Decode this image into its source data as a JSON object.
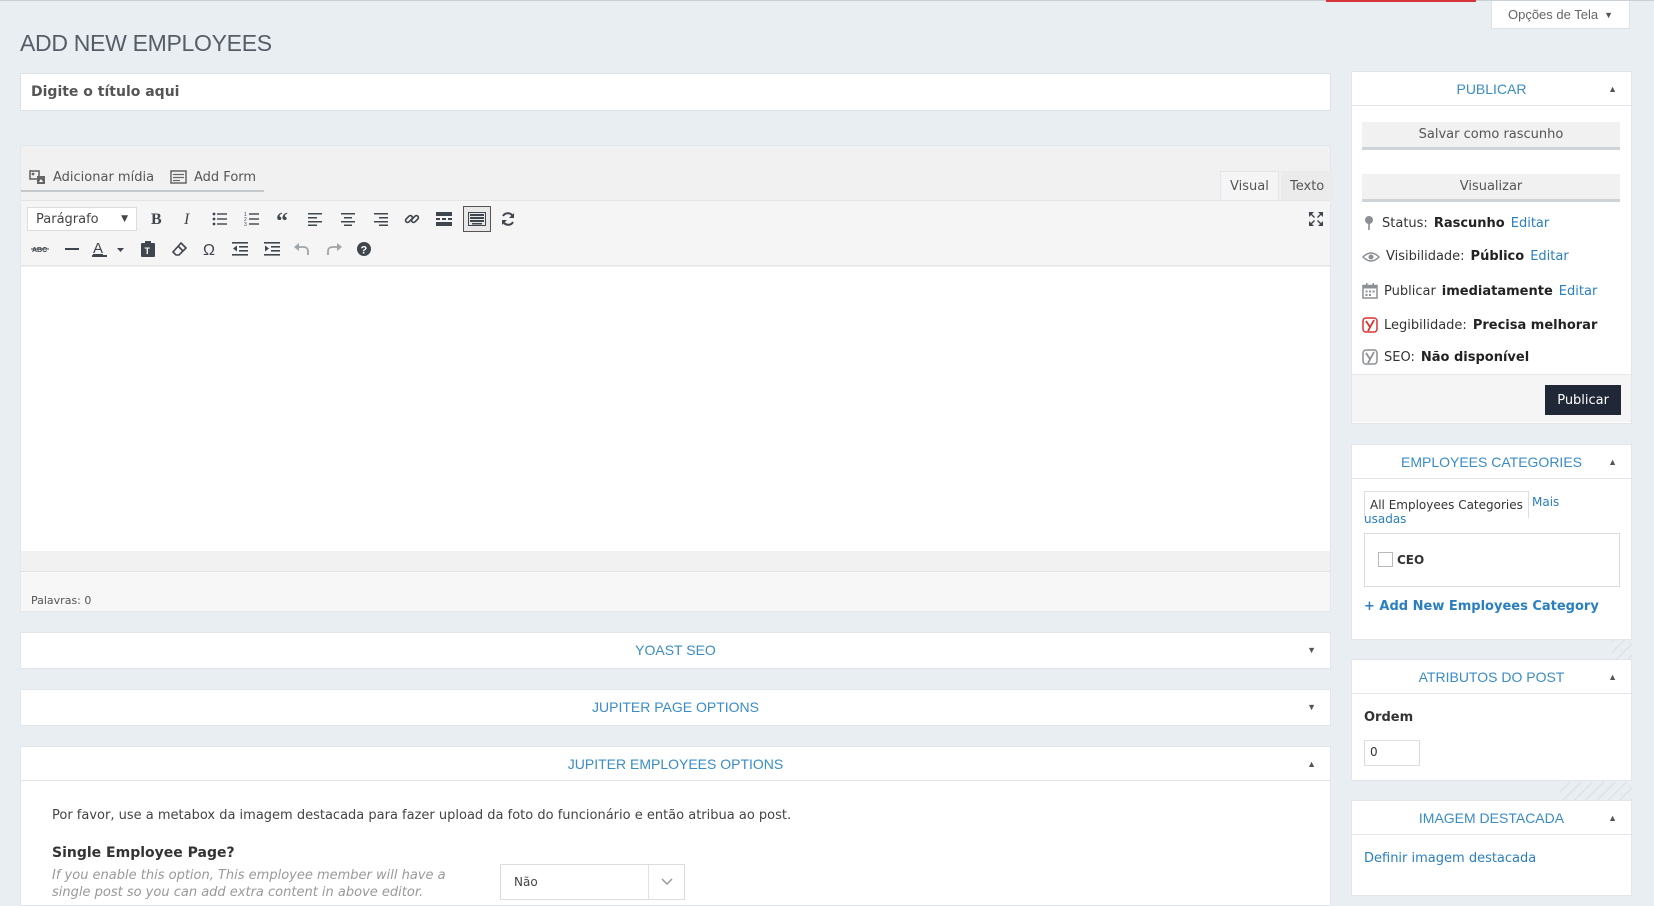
{
  "screen_options": {
    "label": "Opções de Tela"
  },
  "page": {
    "title": "ADD NEW EMPLOYEES"
  },
  "title_field": {
    "placeholder": "Digite o título aqui"
  },
  "editor": {
    "add_media": "Adicionar mídia",
    "add_form": "Add Form",
    "tabs": {
      "visual": "Visual",
      "text": "Texto"
    },
    "format_select": "Parágrafo",
    "word_count": "Palavras: 0"
  },
  "metaboxes": {
    "yoast": "YOAST SEO",
    "jupiter_page": "JUPITER PAGE OPTIONS",
    "jupiter_employees": {
      "title": "JUPITER EMPLOYEES OPTIONS",
      "description": "Por favor, use a metabox da imagem destacada para fazer upload da foto do funcionário e então atribua ao post.",
      "single_label": "Single Employee Page?",
      "single_desc": "If you enable this option, This employee member will have a single post so you can add extra content in above editor.",
      "single_value": "Não"
    }
  },
  "publish": {
    "title": "PUBLICAR",
    "save_draft": "Salvar como rascunho",
    "preview": "Visualizar",
    "status_label": "Status:",
    "status_value": "Rascunho",
    "visibility_label": "Visibilidade:",
    "visibility_value": "Público",
    "schedule_label": "Publicar",
    "schedule_value": "imediatamente",
    "readability_label": "Legibilidade:",
    "readability_value": "Precisa melhorar",
    "seo_label": "SEO:",
    "seo_value": "Não disponível",
    "edit": "Editar",
    "publish_button": "Publicar"
  },
  "categories": {
    "title": "EMPLOYEES CATEGORIES",
    "tab_all": "All Employees Categories",
    "tab_popular_1": "Mais",
    "tab_popular_2": "usadas",
    "items": [
      "CEO"
    ],
    "add_new": "+ Add New Employees Category"
  },
  "attributes": {
    "title": "ATRIBUTOS DO POST",
    "order_label": "Ordem",
    "order_value": "0"
  },
  "featured": {
    "title": "IMAGEM DESTACADA",
    "set_link": "Definir imagem destacada"
  },
  "colors": {
    "link": "#2a7fc0",
    "publish_button": "#202736",
    "background": "#e9eef3"
  }
}
